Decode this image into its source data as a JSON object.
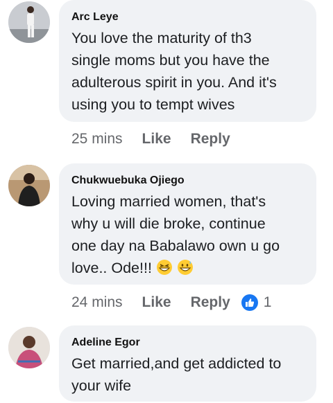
{
  "comments": [
    {
      "author": "Arc Leye",
      "text": "You love the maturity of th3\nsingle moms but you have the\nadulterous spirit in you. And it's\nusing you to tempt wives",
      "time": "25 mins",
      "like_label": "Like",
      "reply_label": "Reply",
      "avatar_icon": "person-standing-avatar"
    },
    {
      "author": "Chukwuebuka Ojiego",
      "text": "Loving married women, that's\nwhy u will die broke, continue\none day na Babalawo own u go\nlove.. Ode!!!",
      "emojis": [
        "grinning-squinting-emoji",
        "grinning-sweat-emoji"
      ],
      "time": "24 mins",
      "like_label": "Like",
      "reply_label": "Reply",
      "reaction_count": "1",
      "reaction_icon": "like-thumb-icon",
      "avatar_icon": "person-avatar"
    },
    {
      "author": "Adeline Egor",
      "text": "Get married,and get addicted to\nyour wife",
      "avatar_icon": "person-avatar"
    }
  ],
  "colors": {
    "bubble": "#f0f2f5",
    "meta_text": "#65676b",
    "reaction_blue": "#1877f2"
  }
}
